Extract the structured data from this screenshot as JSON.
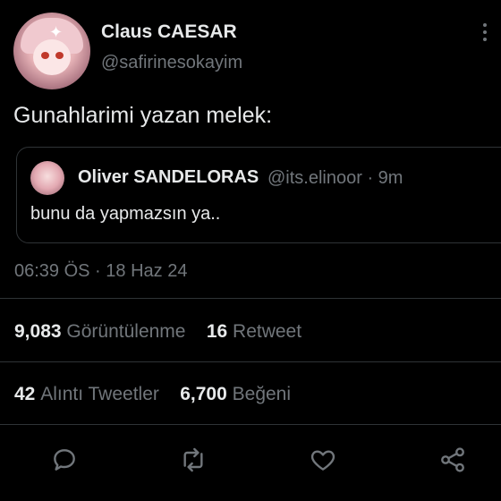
{
  "author": {
    "name": "Claus CAESAR",
    "handle": "@safirinesokayim"
  },
  "tweet": {
    "text": "Gunahlarimi yazan melek:"
  },
  "quoted_tweet": {
    "name": "Oliver SANDELORAS",
    "meta": "@its.elinoor · 9m",
    "text": "bunu da yapmazsın ya.."
  },
  "timestamp": "06:39 ÖS · 18 Haz 24",
  "stats": {
    "views_count": "9,083",
    "views_label": "Görüntülenme",
    "retweets_count": "16",
    "retweets_label": "Retweet",
    "quotes_count": "42",
    "quotes_label": "Alıntı Tweetler",
    "likes_count": "6,700",
    "likes_label": "Beğeni"
  },
  "actions": {
    "reply_icon": "reply-icon",
    "retweet_icon": "retweet-icon",
    "like_icon": "heart-icon",
    "share_icon": "share-icon"
  },
  "colors": {
    "background": "#000000",
    "text": "#e7e9ea",
    "secondary": "#71767b",
    "border": "#2f3336"
  }
}
